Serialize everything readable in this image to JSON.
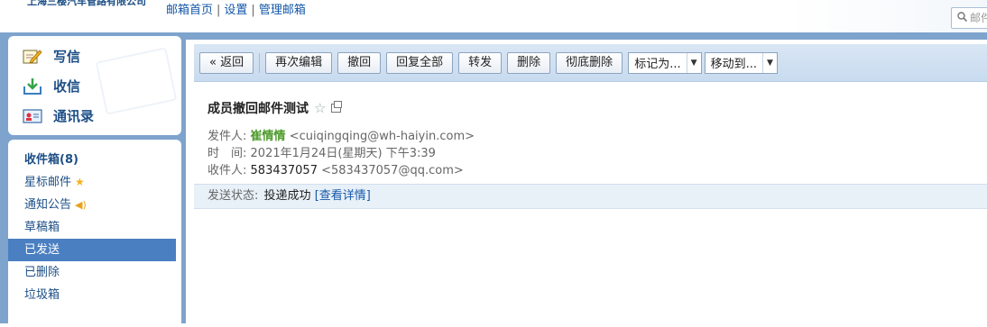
{
  "header": {
    "company": "上海三樱汽车管路有限公司",
    "links": [
      "邮箱首页",
      "设置",
      "管理邮箱"
    ],
    "search_placeholder": "邮件"
  },
  "nav": {
    "primary": [
      {
        "label": "写信",
        "icon": "compose-icon"
      },
      {
        "label": "收信",
        "icon": "inbox-download-icon"
      },
      {
        "label": "通讯录",
        "icon": "contacts-icon"
      }
    ],
    "folders": [
      {
        "label": "收件箱(8)",
        "bold": true
      },
      {
        "label": "星标邮件",
        "icon": "star-icon"
      },
      {
        "label": "通知公告",
        "icon": "speaker-icon"
      },
      {
        "label": "草稿箱"
      },
      {
        "label": "已发送",
        "active": true
      },
      {
        "label": "已删除"
      },
      {
        "label": "垃圾箱"
      }
    ]
  },
  "toolbar": {
    "back": "« 返回",
    "buttons": [
      "再次编辑",
      "撤回",
      "回复全部",
      "转发",
      "删除",
      "彻底删除"
    ],
    "mark_as": "标记为...",
    "move_to": "移动到..."
  },
  "mail": {
    "subject": "成员撤回邮件测试",
    "from_label": "发件人:",
    "from_name": "崔情情",
    "from_addr": "<cuiqingqing@wh-haiyin.com>",
    "time_label": "时　间:",
    "time_value": "2021年1月24日(星期天) 下午3:39",
    "to_label": "收件人:",
    "to_name": "583437057",
    "to_addr": "<583437057@qq.com>"
  },
  "status": {
    "label": "发送状态:",
    "value": "投递成功",
    "detail_link": "[查看详情]"
  },
  "colors": {
    "frame_blue": "#7ea3cd",
    "nav_text": "#1d4f86",
    "active_folder_bg": "#4a7fc1",
    "sender_green": "#4c9a2a",
    "link_blue": "#1558a8"
  }
}
